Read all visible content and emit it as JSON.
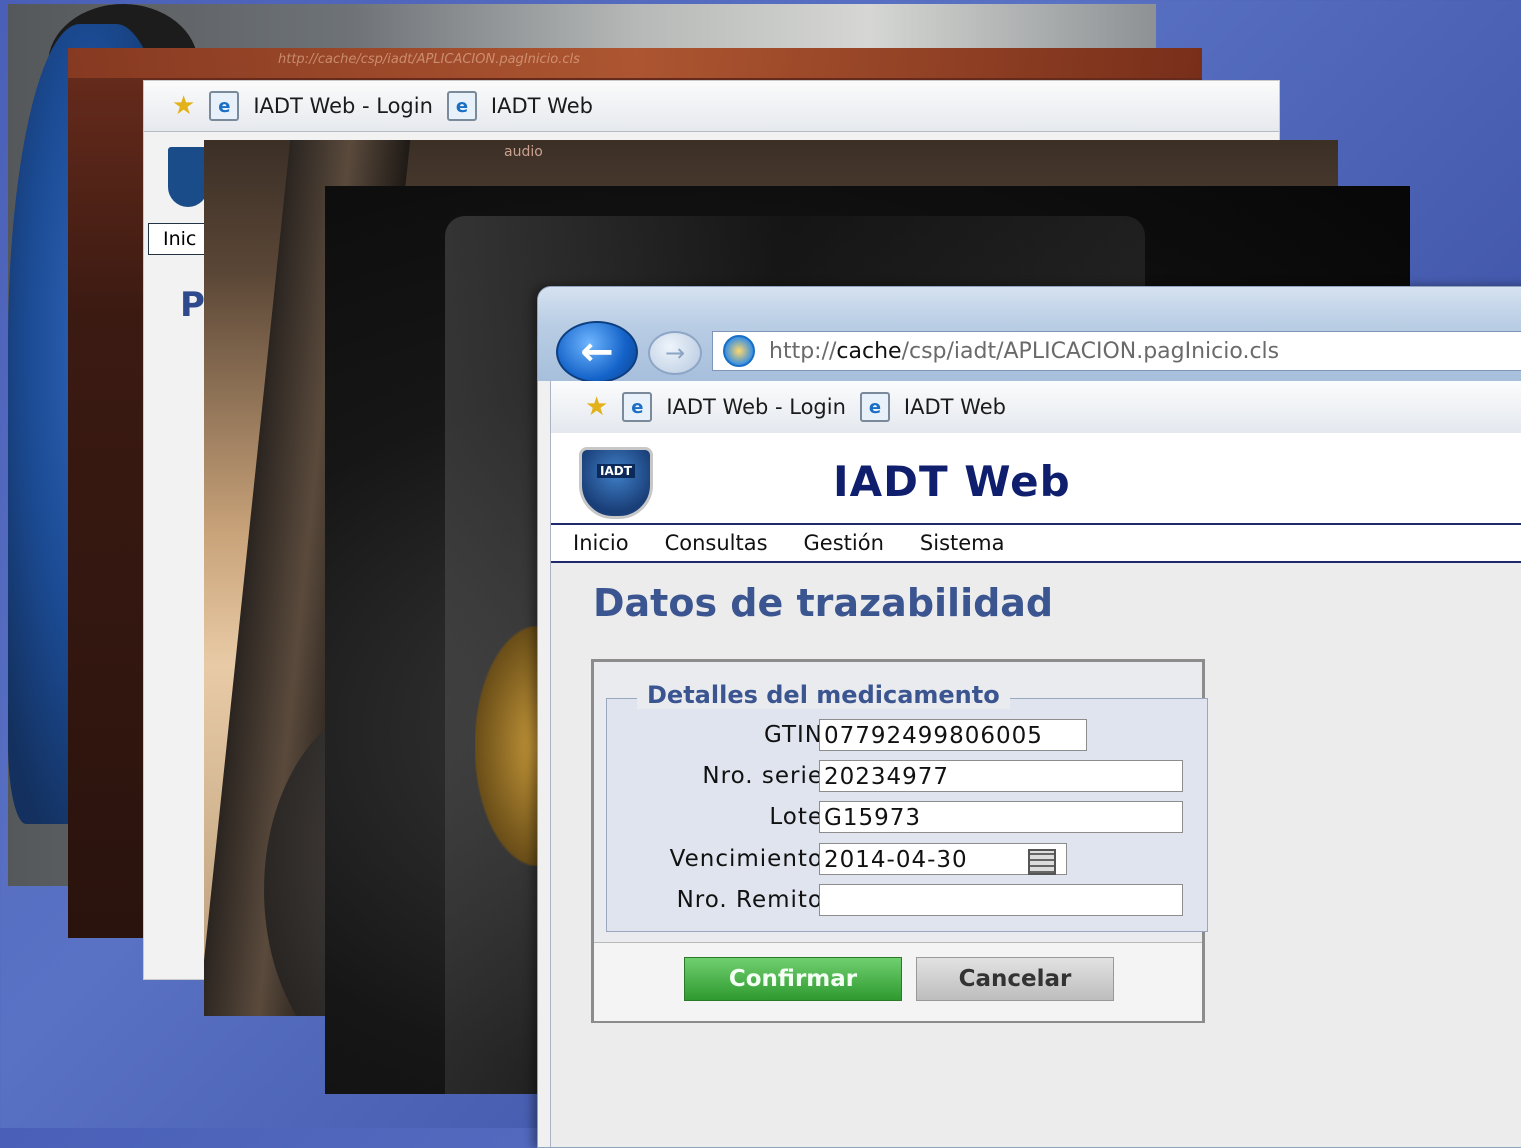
{
  "layers": {
    "card2_url": "http://cache/csp/iadt/APLICACION.pagInicio.cls",
    "card3_favorites": [
      "IADT Web - Login",
      "IADT Web"
    ],
    "card3_menu_first": "Inic",
    "card3_title_fragment": "P",
    "card4_text": "audio"
  },
  "browser": {
    "back_icon": "back-arrow-icon",
    "forward_icon": "forward-arrow-icon",
    "url_prefix": "http://",
    "url_host": "cache",
    "url_path": "/csp/iadt/APLICACION.pagInicio.cls",
    "favorites": [
      "IADT Web - Login",
      "IADT Web"
    ]
  },
  "app": {
    "logo_text": "IADT",
    "title": "IADT Web",
    "menu": [
      "Inicio",
      "Consultas",
      "Gestión",
      "Sistema"
    ]
  },
  "page": {
    "title": "Datos de trazabilidad",
    "fieldset_legend": "Detalles del medicamento",
    "fields": {
      "gtin": {
        "label": "GTIN",
        "value": "07792499806005"
      },
      "serie": {
        "label": "Nro. serie",
        "value": "20234977"
      },
      "lote": {
        "label": "Lote",
        "value": "G15973"
      },
      "vencimiento": {
        "label": "Vencimiento",
        "value": "2014-04-30"
      },
      "remito": {
        "label": "Nro. Remito",
        "value": ""
      }
    },
    "buttons": {
      "confirm": "Confirmar",
      "cancel": "Cancelar"
    }
  },
  "colors": {
    "background": "#4a60b8",
    "title_navy": "#0f1f6e",
    "heading_blue": "#3b5590",
    "confirm_green": "#2f9a2f"
  }
}
